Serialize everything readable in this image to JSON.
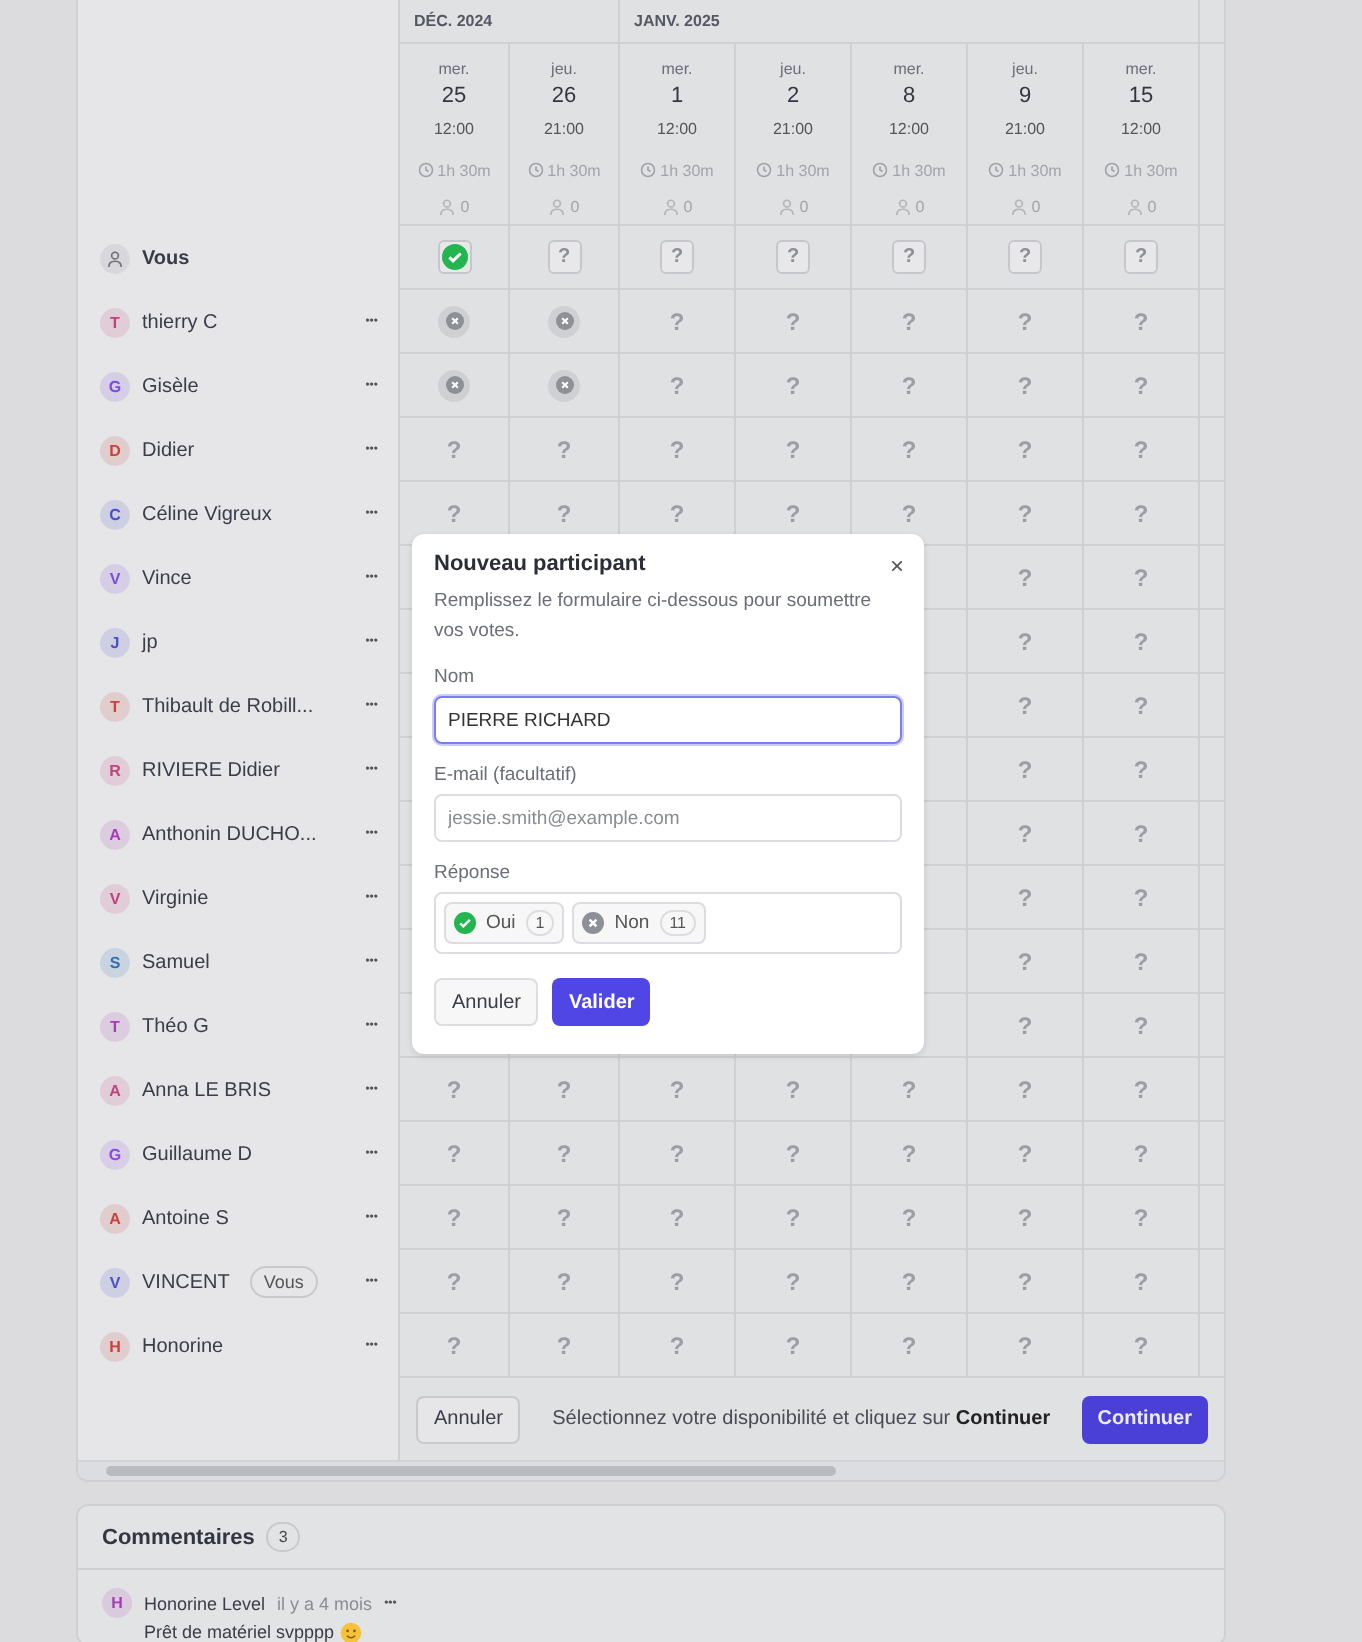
{
  "months": [
    {
      "label": "DÉC. 2024",
      "dates": [
        {
          "weekday": "mer.",
          "day": "25",
          "time": "12:00",
          "duration": "1h 30m",
          "count": "0"
        },
        {
          "weekday": "jeu.",
          "day": "26",
          "time": "21:00",
          "duration": "1h 30m",
          "count": "0"
        }
      ]
    },
    {
      "label": "JANV. 2025",
      "dates": [
        {
          "weekday": "mer.",
          "day": "1",
          "time": "12:00",
          "duration": "1h 30m",
          "count": "0"
        },
        {
          "weekday": "jeu.",
          "day": "2",
          "time": "21:00",
          "duration": "1h 30m",
          "count": "0"
        },
        {
          "weekday": "mer.",
          "day": "8",
          "time": "12:00",
          "duration": "1h 30m",
          "count": "0"
        },
        {
          "weekday": "jeu.",
          "day": "9",
          "time": "21:00",
          "duration": "1h 30m",
          "count": "0"
        },
        {
          "weekday": "mer.",
          "day": "15",
          "time": "12:00",
          "duration": "1h 30m",
          "count": "0"
        }
      ]
    }
  ],
  "you": {
    "name": "Vous",
    "votes": [
      {
        "kind": "yes"
      },
      {
        "kind": "unknown",
        "label": "?"
      },
      {
        "kind": "unknown",
        "label": "?"
      },
      {
        "kind": "unknown",
        "label": "?"
      },
      {
        "kind": "unknown",
        "label": "?"
      },
      {
        "kind": "unknown",
        "label": "?"
      },
      {
        "kind": "unknown",
        "label": "?"
      }
    ]
  },
  "participants": [
    {
      "initial": "T",
      "name": "thierry C",
      "color": "#c2417f",
      "more": "•••",
      "votes": [
        {
          "kind": "no"
        },
        {
          "kind": "no"
        },
        {
          "kind": "unknown",
          "label": "?"
        },
        {
          "kind": "unknown",
          "label": "?"
        },
        {
          "kind": "unknown",
          "label": "?"
        },
        {
          "kind": "unknown",
          "label": "?"
        },
        {
          "kind": "unknown",
          "label": "?"
        }
      ]
    },
    {
      "initial": "G",
      "name": "Gisèle",
      "color": "#7c4ddb",
      "more": "•••",
      "votes": [
        {
          "kind": "no"
        },
        {
          "kind": "no"
        },
        {
          "kind": "unknown",
          "label": "?"
        },
        {
          "kind": "unknown",
          "label": "?"
        },
        {
          "kind": "unknown",
          "label": "?"
        },
        {
          "kind": "unknown",
          "label": "?"
        },
        {
          "kind": "unknown",
          "label": "?"
        }
      ]
    },
    {
      "initial": "D",
      "name": "Didier",
      "color": "#c9423a",
      "more": "•••",
      "votes": [
        {
          "kind": "unknown",
          "label": "?"
        },
        {
          "kind": "unknown",
          "label": "?"
        },
        {
          "kind": "unknown",
          "label": "?"
        },
        {
          "kind": "unknown",
          "label": "?"
        },
        {
          "kind": "unknown",
          "label": "?"
        },
        {
          "kind": "unknown",
          "label": "?"
        },
        {
          "kind": "unknown",
          "label": "?"
        }
      ]
    },
    {
      "initial": "C",
      "name": "Céline Vigreux",
      "color": "#4a50c9",
      "more": "•••",
      "votes": [
        {
          "kind": "unknown",
          "label": "?"
        },
        {
          "kind": "unknown",
          "label": "?"
        },
        {
          "kind": "unknown",
          "label": "?"
        },
        {
          "kind": "unknown",
          "label": "?"
        },
        {
          "kind": "unknown",
          "label": "?"
        },
        {
          "kind": "unknown",
          "label": "?"
        },
        {
          "kind": "unknown",
          "label": "?"
        }
      ]
    },
    {
      "initial": "V",
      "name": "Vince",
      "color": "#7c4ddb",
      "more": "•••",
      "votes": [
        {
          "kind": "unknown",
          "label": "?"
        },
        {
          "kind": "unknown",
          "label": "?"
        }
      ]
    },
    {
      "initial": "J",
      "name": "jp",
      "color": "#4a50c9",
      "more": "•••",
      "votes": [
        {
          "kind": "unknown",
          "label": "?"
        },
        {
          "kind": "unknown",
          "label": "?"
        }
      ]
    },
    {
      "initial": "T",
      "name": "Thibault de Robill...",
      "color": "#c9423a",
      "more": "•••",
      "votes": [
        {
          "kind": "unknown",
          "label": "?"
        },
        {
          "kind": "unknown",
          "label": "?"
        }
      ]
    },
    {
      "initial": "R",
      "name": "RIVIERE Didier",
      "color": "#c2417f",
      "more": "•••",
      "votes": [
        {
          "kind": "unknown",
          "label": "?"
        },
        {
          "kind": "unknown",
          "label": "?"
        }
      ]
    },
    {
      "initial": "A",
      "name": "Anthonin DUCHO...",
      "color": "#a63cb5",
      "more": "•••",
      "votes": [
        {
          "kind": "unknown",
          "label": "?"
        },
        {
          "kind": "unknown",
          "label": "?"
        }
      ]
    },
    {
      "initial": "V",
      "name": "Virginie",
      "color": "#c2417f",
      "more": "•••",
      "votes": [
        {
          "kind": "unknown",
          "label": "?"
        },
        {
          "kind": "unknown",
          "label": "?"
        }
      ]
    },
    {
      "initial": "S",
      "name": "Samuel",
      "color": "#2f6fb8",
      "more": "•••",
      "votes": [
        {
          "kind": "unknown",
          "label": "?"
        },
        {
          "kind": "unknown",
          "label": "?"
        }
      ]
    },
    {
      "initial": "T",
      "name": "Théo G",
      "color": "#a63cb5",
      "more": "•••",
      "votes": [
        {
          "kind": "unknown",
          "label": "?"
        },
        {
          "kind": "unknown",
          "label": "?"
        }
      ]
    },
    {
      "initial": "A",
      "name": "Anna LE BRIS",
      "color": "#c2417f",
      "more": "•••",
      "votes": [
        {
          "kind": "unknown",
          "label": "?"
        },
        {
          "kind": "unknown",
          "label": "?"
        },
        {
          "kind": "unknown",
          "label": "?"
        },
        {
          "kind": "unknown",
          "label": "?"
        },
        {
          "kind": "unknown",
          "label": "?"
        },
        {
          "kind": "unknown",
          "label": "?"
        },
        {
          "kind": "unknown",
          "label": "?"
        }
      ]
    },
    {
      "initial": "G",
      "name": "Guillaume D",
      "color": "#8a4ddb",
      "more": "•••",
      "votes": [
        {
          "kind": "unknown",
          "label": "?"
        },
        {
          "kind": "unknown",
          "label": "?"
        },
        {
          "kind": "unknown",
          "label": "?"
        },
        {
          "kind": "unknown",
          "label": "?"
        },
        {
          "kind": "unknown",
          "label": "?"
        },
        {
          "kind": "unknown",
          "label": "?"
        },
        {
          "kind": "unknown",
          "label": "?"
        }
      ]
    },
    {
      "initial": "A",
      "name": "Antoine S",
      "color": "#c9423a",
      "more": "•••",
      "votes": [
        {
          "kind": "unknown",
          "label": "?"
        },
        {
          "kind": "unknown",
          "label": "?"
        },
        {
          "kind": "unknown",
          "label": "?"
        },
        {
          "kind": "unknown",
          "label": "?"
        },
        {
          "kind": "unknown",
          "label": "?"
        },
        {
          "kind": "unknown",
          "label": "?"
        },
        {
          "kind": "unknown",
          "label": "?"
        }
      ]
    },
    {
      "initial": "V",
      "name": "VINCENT",
      "badge": "Vous",
      "color": "#4a50c9",
      "more": "•••",
      "votes": [
        {
          "kind": "unknown",
          "label": "?"
        },
        {
          "kind": "unknown",
          "label": "?"
        },
        {
          "kind": "unknown",
          "label": "?"
        },
        {
          "kind": "unknown",
          "label": "?"
        },
        {
          "kind": "unknown",
          "label": "?"
        },
        {
          "kind": "unknown",
          "label": "?"
        },
        {
          "kind": "unknown",
          "label": "?"
        }
      ]
    },
    {
      "initial": "H",
      "name": "Honorine",
      "color": "#c9423a",
      "more": "•••",
      "votes": [
        {
          "kind": "unknown",
          "label": "?"
        },
        {
          "kind": "unknown",
          "label": "?"
        },
        {
          "kind": "unknown",
          "label": "?"
        },
        {
          "kind": "unknown",
          "label": "?"
        },
        {
          "kind": "unknown",
          "label": "?"
        },
        {
          "kind": "unknown",
          "label": "?"
        },
        {
          "kind": "unknown",
          "label": "?"
        }
      ]
    }
  ],
  "footer": {
    "cancel": "Annuler",
    "hint": "Sélectionnez votre disponibilité et cliquez sur **Continuer**",
    "continue": "Continuer"
  },
  "comments": {
    "title": "Commentaires",
    "count": "3",
    "items": [
      {
        "initial": "H",
        "author": "Honorine Level",
        "color": "#a63cb5",
        "time": "il y a 4 mois",
        "more": "•••",
        "text": "Prêt de matériel svpppp"
      }
    ]
  },
  "dialog": {
    "title": "Nouveau participant",
    "close": "×",
    "description": "Remplissez le formulaire ci-dessous pour soumettre vos votes.",
    "name_label": "Nom",
    "name_value": "PIERRE RICHARD",
    "email_label": "E-mail (facultatif)",
    "email_placeholder": "jessie.smith@example.com",
    "response_label": "Réponse",
    "responses": [
      {
        "kind": "yes",
        "label": "Oui",
        "count": "1"
      },
      {
        "kind": "no",
        "label": "Non",
        "count": "11"
      }
    ],
    "cancel": "Annuler",
    "submit": "Valider"
  }
}
